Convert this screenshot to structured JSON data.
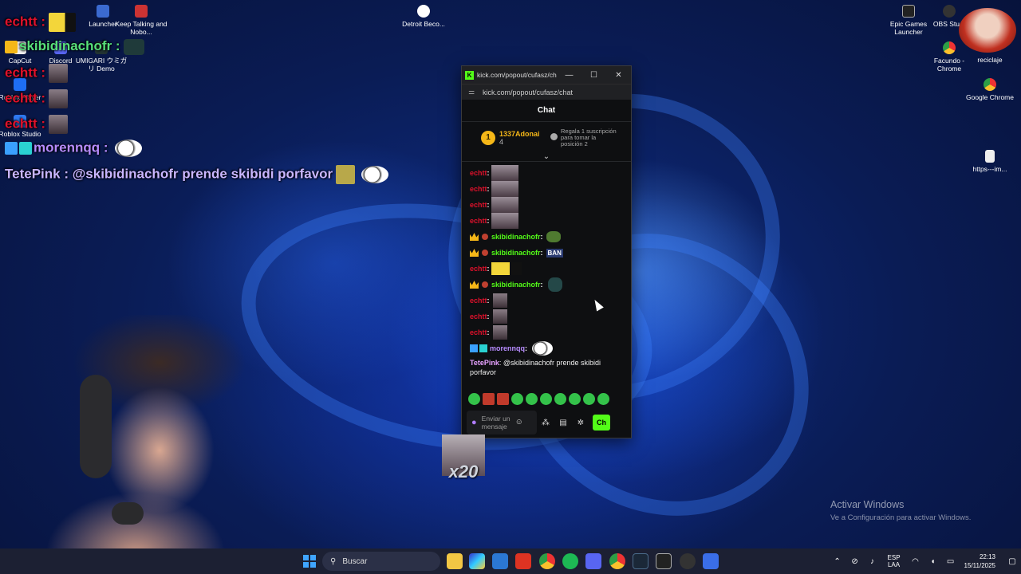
{
  "desktop": {
    "icons_left": [
      {
        "label": "Launcher",
        "icon": "launcher-icon"
      },
      {
        "label": "Keep Talking and Nobo...",
        "icon": "game-icon"
      },
      {
        "label": "CapCut",
        "icon": "capcut-icon"
      },
      {
        "label": "Discord",
        "icon": "discord-icon"
      },
      {
        "label": "UMIGARI ウミガリ Demo",
        "icon": "umigari-icon"
      },
      {
        "label": "Roblox Player",
        "icon": "roblox-icon"
      },
      {
        "label": "Roblox Studio",
        "icon": "roblox-studio-icon"
      }
    ],
    "icon_center": {
      "label": "Detroit Beco...",
      "icon": "detroit-icon"
    },
    "icons_right": [
      {
        "label": "Epic Games Launcher",
        "icon": "epic-icon"
      },
      {
        "label": "OBS Stu...",
        "icon": "obs-icon"
      },
      {
        "label": "Facundo - Chrome",
        "icon": "chrome-icon"
      },
      {
        "label": "reciclaje",
        "icon": "recycle-bin-icon"
      },
      {
        "label": "Google Chrome",
        "icon": "chrome-icon"
      },
      {
        "label": "https---im...",
        "icon": "file-icon"
      }
    ]
  },
  "overlay_chat": [
    {
      "user": "echtt",
      "text": ":",
      "color": "#e0112b",
      "emote": "car-emote"
    },
    {
      "user": "skibidinachofr",
      "text": ":",
      "color": "#57e07a",
      "emote": "frog-emote"
    },
    {
      "user": "echtt",
      "text": ":",
      "color": "#e0112b",
      "emote": "face-emote"
    },
    {
      "user": "echtt",
      "text": ":",
      "color": "#e0112b",
      "emote": "face-emote"
    },
    {
      "user": "echtt",
      "text": ":",
      "color": "#e0112b",
      "emote": "face-emote"
    },
    {
      "user": "morennqq",
      "text": ":",
      "color": "#b78cff",
      "emote": "cow-emote"
    },
    {
      "user": "TetePink",
      "text": ": @skibidinachofr prende skibidi porfavor",
      "color": "#c9b6ff",
      "emote": "cow-emote"
    }
  ],
  "browser": {
    "title": "kick.com/popout/cufasz/ch...",
    "url": "kick.com/popout/cufasz/chat",
    "minimize": "—",
    "maximize": "☐",
    "close": "✕"
  },
  "chat": {
    "header": "Chat",
    "leaderboard": {
      "rank": "1",
      "user": "1337Adonai",
      "count": "4",
      "gift_text": "Regala 1 suscripción para tomar la posición 2"
    },
    "messages": [
      {
        "user": "echtt",
        "color": "u-red",
        "emote": "emote-face"
      },
      {
        "user": "echtt",
        "color": "u-red",
        "emote": "emote-face"
      },
      {
        "user": "echtt",
        "color": "u-red",
        "emote": "emote-face"
      },
      {
        "user": "echtt",
        "color": "u-red",
        "emote": "emote-face"
      },
      {
        "user": "skibidinachofr",
        "color": "u-green",
        "emote": "emote-pepe",
        "badges": true
      },
      {
        "user": "skibidinachofr",
        "color": "u-green",
        "emote": "emote-ban",
        "emote_text": "BAN",
        "badges": true
      },
      {
        "user": "echtt",
        "color": "u-red",
        "emote": "emote-car"
      },
      {
        "user": "skibidinachofr",
        "color": "u-green",
        "emote": "emote-frog",
        "badges": true
      },
      {
        "user": "echtt",
        "color": "u-red",
        "emote": "emote-sm"
      },
      {
        "user": "echtt",
        "color": "u-red",
        "emote": "emote-sm"
      },
      {
        "user": "echtt",
        "color": "u-red",
        "emote": "emote-sm"
      },
      {
        "user": "morennqq",
        "color": "u-purple",
        "emote": "emote-cow",
        "kick_badge": true
      }
    ],
    "last_message": {
      "user": "TetePink",
      "text": "@skibidinachofr prende skibidi porfavor"
    },
    "composer_placeholder": "Enviar un mensaje",
    "send_label": "Ch"
  },
  "stream_overlay": {
    "x20_label": "x20"
  },
  "activation": {
    "title": "Activar Windows",
    "subtitle": "Ve a Configuración para activar Windows."
  },
  "taskbar": {
    "search_placeholder": "Buscar",
    "language_top": "ESP",
    "language_bottom": "LAA",
    "time": "22:13",
    "date": "15/11/2025"
  }
}
